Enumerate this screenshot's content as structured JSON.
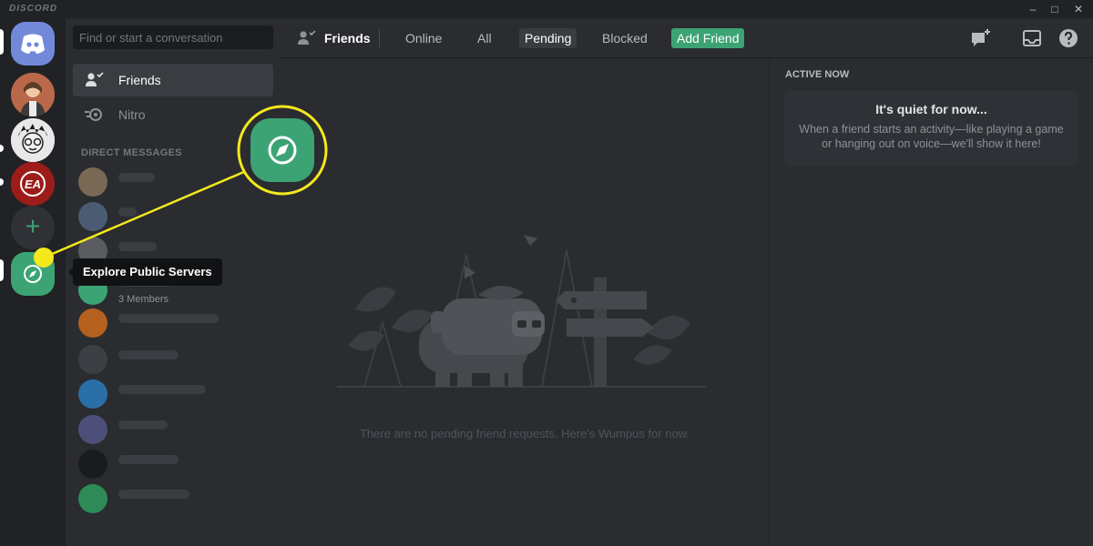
{
  "app": {
    "brand": "DISCORD"
  },
  "window_controls": [
    "–",
    "□",
    "✕"
  ],
  "search": {
    "placeholder": "Find or start a conversation"
  },
  "sidebar": {
    "items": [
      {
        "label": "Friends",
        "icon": "friends-icon"
      },
      {
        "label": "Nitro",
        "icon": "nitro-icon"
      }
    ],
    "dm_header": "DIRECT MESSAGES",
    "dm_group_subtitle": "3 Members"
  },
  "header": {
    "title": "Friends",
    "tabs": [
      {
        "label": "Online"
      },
      {
        "label": "All"
      },
      {
        "label": "Pending",
        "selected": true
      },
      {
        "label": "Blocked"
      }
    ],
    "add_friend": "Add Friend"
  },
  "main": {
    "empty_text": "There are no pending friend requests. Here's Wumpus for now."
  },
  "active_now": {
    "heading": "ACTIVE NOW",
    "title": "It's quiet for now...",
    "body": "When a friend starts an activity—like playing a game or hanging out on voice—we'll show it here!"
  },
  "rail": {
    "add_server": "+",
    "explore_tooltip": "Explore Public Servers",
    "badge_ea": "EA"
  },
  "colors": {
    "blurple": "#7289da",
    "green": "#3ca374",
    "highlight": "#f5e81c"
  }
}
